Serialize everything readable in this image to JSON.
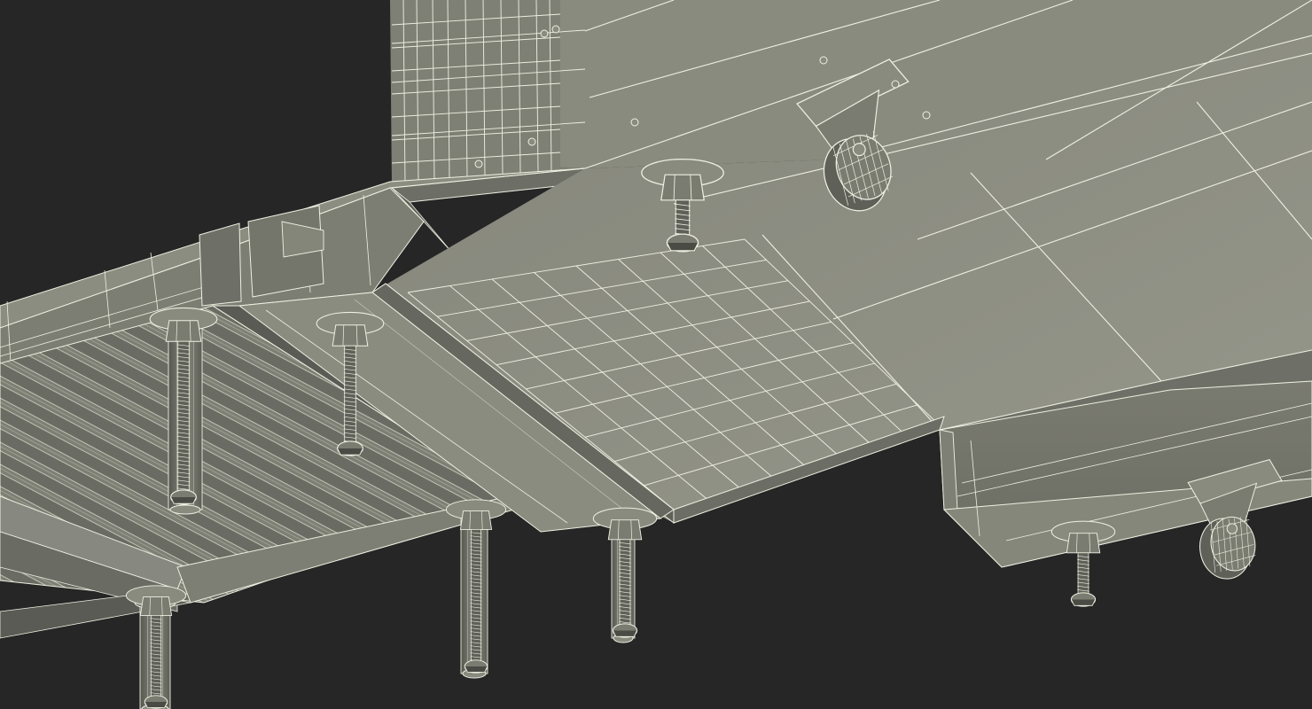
{
  "scene": {
    "subject": "wireframe-render-underside-of-table",
    "colors": {
      "background": "#262626",
      "surface_light": "#8a8b7f",
      "surface_mid": "#7b7c71",
      "surface_dark": "#5f6058",
      "surface_shadow": "#4a4b45",
      "wire": "#eef0e2",
      "wire_soft": "#c9cbbd"
    },
    "parts": {
      "adjustable_feet": 7,
      "caster_wheels": 2,
      "leg_columns": 4
    }
  }
}
